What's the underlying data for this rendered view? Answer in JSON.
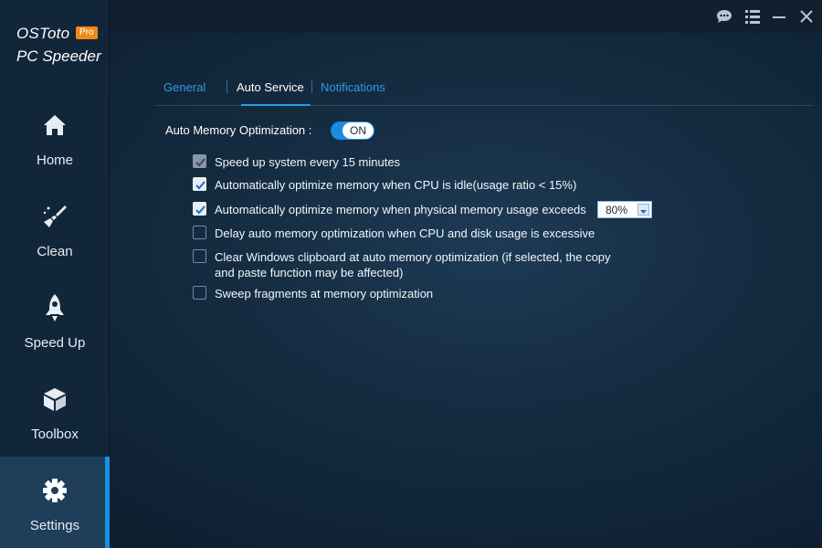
{
  "brand": {
    "name": "OSToto",
    "badge": "Pro",
    "subtitle": "PC Speeder"
  },
  "nav": {
    "items": [
      {
        "label": "Home",
        "icon": "home-icon"
      },
      {
        "label": "Clean",
        "icon": "broom-icon"
      },
      {
        "label": "Speed Up",
        "icon": "rocket-icon"
      },
      {
        "label": "Toolbox",
        "icon": "box-icon"
      },
      {
        "label": "Settings",
        "icon": "gear-icon",
        "active": true
      }
    ]
  },
  "titlebar": {
    "icons": [
      "chat-icon",
      "menu-icon",
      "minimize-icon",
      "close-icon"
    ]
  },
  "tabs": [
    {
      "label": "General"
    },
    {
      "label": "Auto Service",
      "active": true
    },
    {
      "label": "Notifications"
    }
  ],
  "auto_memory": {
    "label": "Auto Memory Optimization :",
    "toggle_label": "ON",
    "options": [
      {
        "text": "Speed up system every 15 minutes",
        "checked": true,
        "disabled": true
      },
      {
        "text": "Automatically optimize memory when CPU is idle(usage ratio < 15%)",
        "checked": true
      },
      {
        "text": "Automatically optimize memory when physical memory usage exceeds",
        "checked": true
      },
      {
        "text": "Delay auto memory optimization when CPU and disk usage is excessive",
        "checked": false
      },
      {
        "text": "Clear Windows clipboard at auto memory optimization (if selected, the copy",
        "text2": "and paste function may be affected)",
        "checked": false
      },
      {
        "text": "Sweep fragments at memory optimization",
        "checked": false
      }
    ],
    "threshold_select": {
      "value": "80%"
    }
  },
  "colors": {
    "accent": "#1c8be0",
    "badge": "#f08a1c",
    "link": "#2e9be6"
  }
}
